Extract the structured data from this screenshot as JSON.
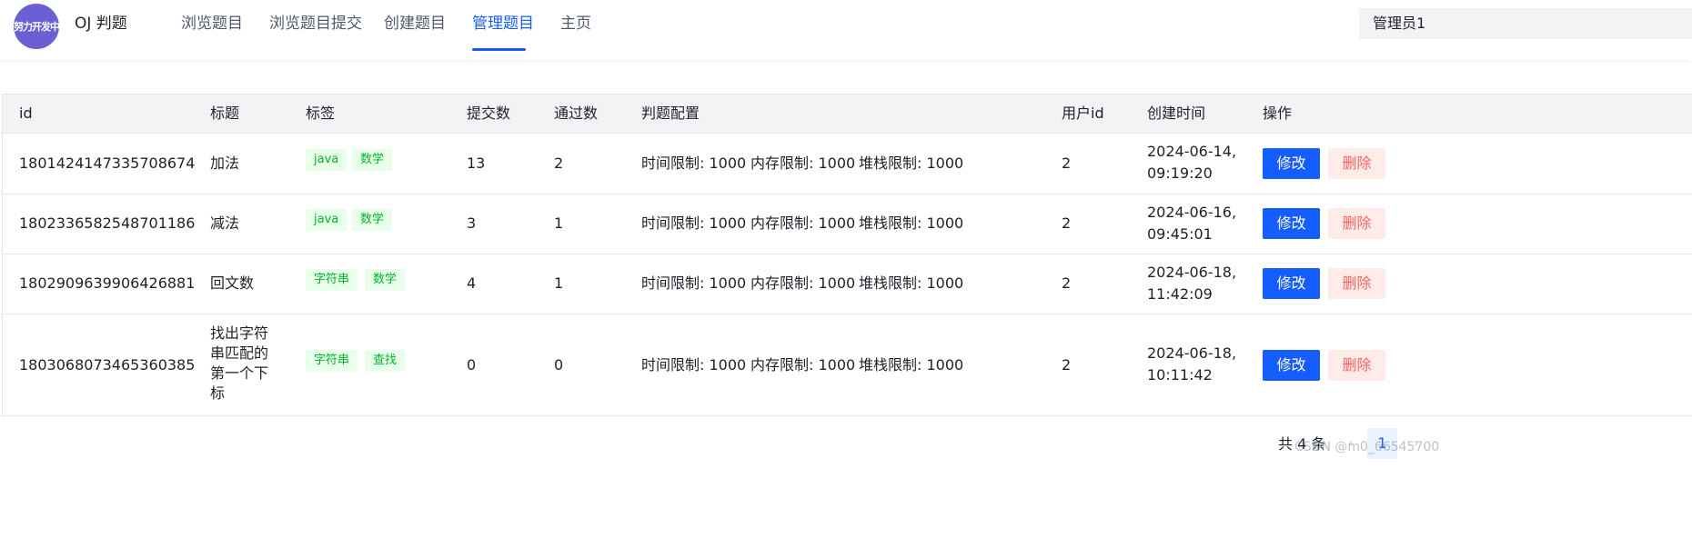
{
  "header": {
    "logo_text": "努力开发中",
    "app_title": "OJ 判题",
    "nav": [
      {
        "label": "浏览题目"
      },
      {
        "label": "浏览题目提交"
      },
      {
        "label": "创建题目"
      },
      {
        "label": "管理题目"
      },
      {
        "label": "主页"
      }
    ],
    "active_nav": "管理题目",
    "user_label": "管理员1"
  },
  "table": {
    "columns": [
      "id",
      "标题",
      "标签",
      "提交数",
      "通过数",
      "判题配置",
      "用户id",
      "创建时间",
      "操作"
    ],
    "rows": [
      {
        "id": "1801424147335708674",
        "title": "加法",
        "tags": [
          "java",
          "数学"
        ],
        "submit": "13",
        "accepted": "2",
        "config": [
          "时间限制: 1000",
          "内存限制: 1000",
          "堆栈限制: 1000"
        ],
        "user_id": "2",
        "created_date": "2024-06-14,",
        "created_time": "09:19:20",
        "edit": "修改",
        "delete": "删除"
      },
      {
        "id": "1802336582548701186",
        "title": "减法",
        "tags": [
          "java",
          "数学"
        ],
        "submit": "3",
        "accepted": "1",
        "config": [
          "时间限制: 1000",
          "内存限制: 1000",
          "堆栈限制: 1000"
        ],
        "user_id": "2",
        "created_date": "2024-06-16,",
        "created_time": "09:45:01",
        "edit": "修改",
        "delete": "删除"
      },
      {
        "id": "1802909639906426881",
        "title": "回文数",
        "tags": [
          "字符串",
          "数学"
        ],
        "submit": "4",
        "accepted": "1",
        "config": [
          "时间限制: 1000",
          "内存限制: 1000",
          "堆栈限制: 1000"
        ],
        "user_id": "2",
        "created_date": "2024-06-18,",
        "created_time": "11:42:09",
        "edit": "修改",
        "delete": "删除"
      },
      {
        "id": "1803068073465360385",
        "title": "找出字符串匹配的第一个下标",
        "tags": [
          "字符串",
          "查找"
        ],
        "submit": "0",
        "accepted": "0",
        "config": [
          "时间限制: 1000",
          "内存限制: 1000",
          "堆栈限制: 1000"
        ],
        "user_id": "2",
        "created_date": "2024-06-18,",
        "created_time": "10:11:42",
        "edit": "修改",
        "delete": "删除"
      }
    ]
  },
  "pagination": {
    "total": "共 4 条",
    "prev": "‹",
    "current_page": "1",
    "next": "›"
  },
  "watermark": "CSDN @m0_66545700"
}
